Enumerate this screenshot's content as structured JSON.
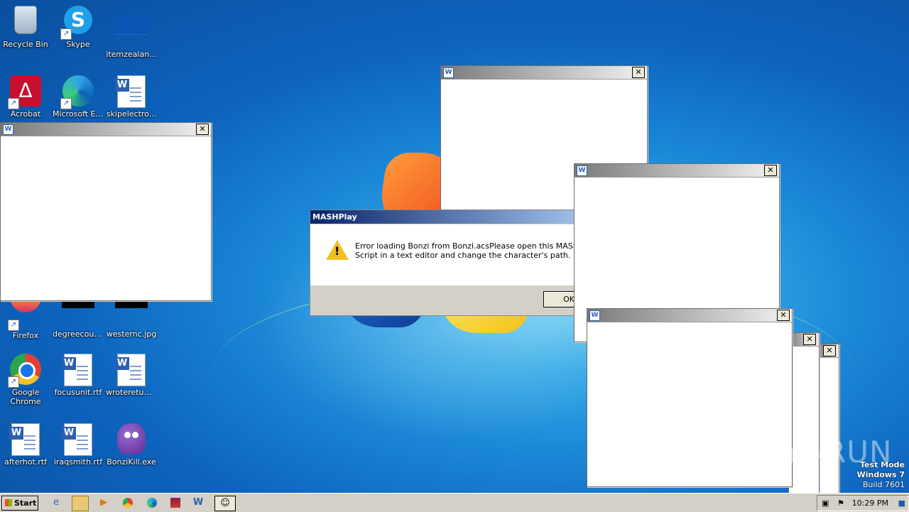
{
  "desktop": {
    "icons": [
      {
        "label": "Recycle Bin",
        "icon": "recycle-bin-icon"
      },
      {
        "label": "Skype",
        "icon": "skype-icon"
      },
      {
        "label": "itemzealan...",
        "icon": "image-file-icon"
      },
      {
        "label": "Acrobat",
        "icon": "acrobat-icon"
      },
      {
        "label": "Microsoft Edge",
        "icon": "edge-icon"
      },
      {
        "label": "skipelectro...",
        "icon": "word-document-icon"
      },
      {
        "label": "Firefox",
        "icon": "firefox-icon"
      },
      {
        "label": "degreecoun...",
        "icon": "image-file-icon"
      },
      {
        "label": "westernc.jpg",
        "icon": "image-file-icon"
      },
      {
        "label": "Google Chrome",
        "icon": "chrome-icon"
      },
      {
        "label": "focusunit.rtf",
        "icon": "word-document-icon"
      },
      {
        "label": "wroteretum...",
        "icon": "word-document-icon"
      },
      {
        "label": "afterhot.rtf",
        "icon": "word-document-icon"
      },
      {
        "label": "iraqsmith.rtf",
        "icon": "word-document-icon"
      },
      {
        "label": "BonziKill.exe",
        "icon": "bonzi-icon"
      }
    ]
  },
  "dialog": {
    "title": "MASHPlay",
    "message": "Error loading Bonzi from Bonzi.acsPlease open this MASH Script in a text editor and change the character's path.",
    "ok_label": "OK"
  },
  "blank_windows": {
    "close_glyph": "✕"
  },
  "watermark": {
    "text": "ANY▷RUN"
  },
  "test_mode": {
    "line1": "Test Mode",
    "line2": "Windows 7",
    "line3": "Build 7601"
  },
  "taskbar": {
    "start_label": "Start",
    "clock": "10:29 PM",
    "quick_launch": [
      "ie-icon",
      "explorer-icon",
      "media-player-icon",
      "chrome-icon",
      "edge-icon",
      "winrar-icon",
      "word-icon",
      "bonzi-icon"
    ]
  }
}
